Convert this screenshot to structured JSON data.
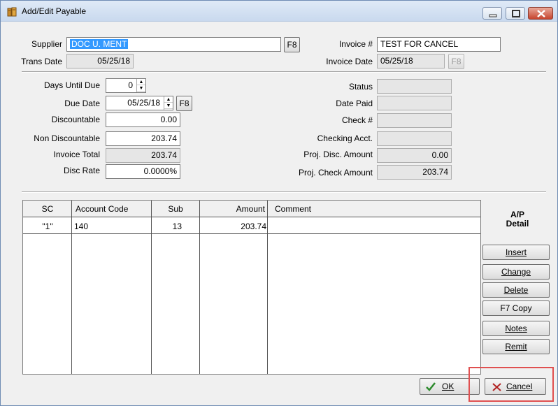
{
  "window": {
    "title": "Add/Edit Payable"
  },
  "form": {
    "supplier": {
      "label": "Supplier",
      "value": "DOC U. MENT",
      "f8": "F8"
    },
    "trans_date": {
      "label": "Trans Date",
      "value": "05/25/18"
    },
    "invoice_no": {
      "label": "Invoice #",
      "value": "TEST FOR CANCEL"
    },
    "invoice_date": {
      "label": "Invoice Date",
      "value": "05/25/18",
      "f8": "F8"
    },
    "days_until_due": {
      "label": "Days Until Due",
      "value": "0"
    },
    "due_date": {
      "label": "Due Date",
      "value": "05/25/18",
      "f8": "F8"
    },
    "discountable": {
      "label": "Discountable",
      "value": "0.00"
    },
    "non_discountable": {
      "label": "Non Discountable",
      "value": "203.74"
    },
    "invoice_total": {
      "label": "Invoice Total",
      "value": "203.74"
    },
    "disc_rate": {
      "label": "Disc Rate",
      "value": "0.0000%"
    },
    "status": {
      "label": "Status",
      "value": ""
    },
    "date_paid": {
      "label": "Date Paid",
      "value": ""
    },
    "check_no": {
      "label": "Check #",
      "value": ""
    },
    "checking_acct": {
      "label": "Checking Acct.",
      "value": ""
    },
    "proj_disc_amount": {
      "label": "Proj. Disc. Amount",
      "value": "0.00"
    },
    "proj_check_amount": {
      "label": "Proj. Check Amount",
      "value": "203.74"
    }
  },
  "grid": {
    "columns": [
      "SC",
      "Account Code",
      "Sub",
      "Amount",
      "Comment"
    ],
    "rows": [
      {
        "sc": "\"1\"",
        "account_code": "140",
        "sub": "13",
        "amount": "203.74",
        "comment": ""
      }
    ]
  },
  "sidebar": {
    "title_line1": "A/P",
    "title_line2": "Detail",
    "insert": "Insert",
    "change": "Change",
    "delete": "Delete",
    "copy": "F7 Copy",
    "notes": "Notes",
    "remit": "Remit"
  },
  "footer": {
    "ok": "OK",
    "cancel": "Cancel"
  },
  "colors": {
    "selection": "#3399ff",
    "ok_check": "#2e8b2e",
    "cancel_x": "#b22222",
    "highlight_box": "#e05050"
  }
}
